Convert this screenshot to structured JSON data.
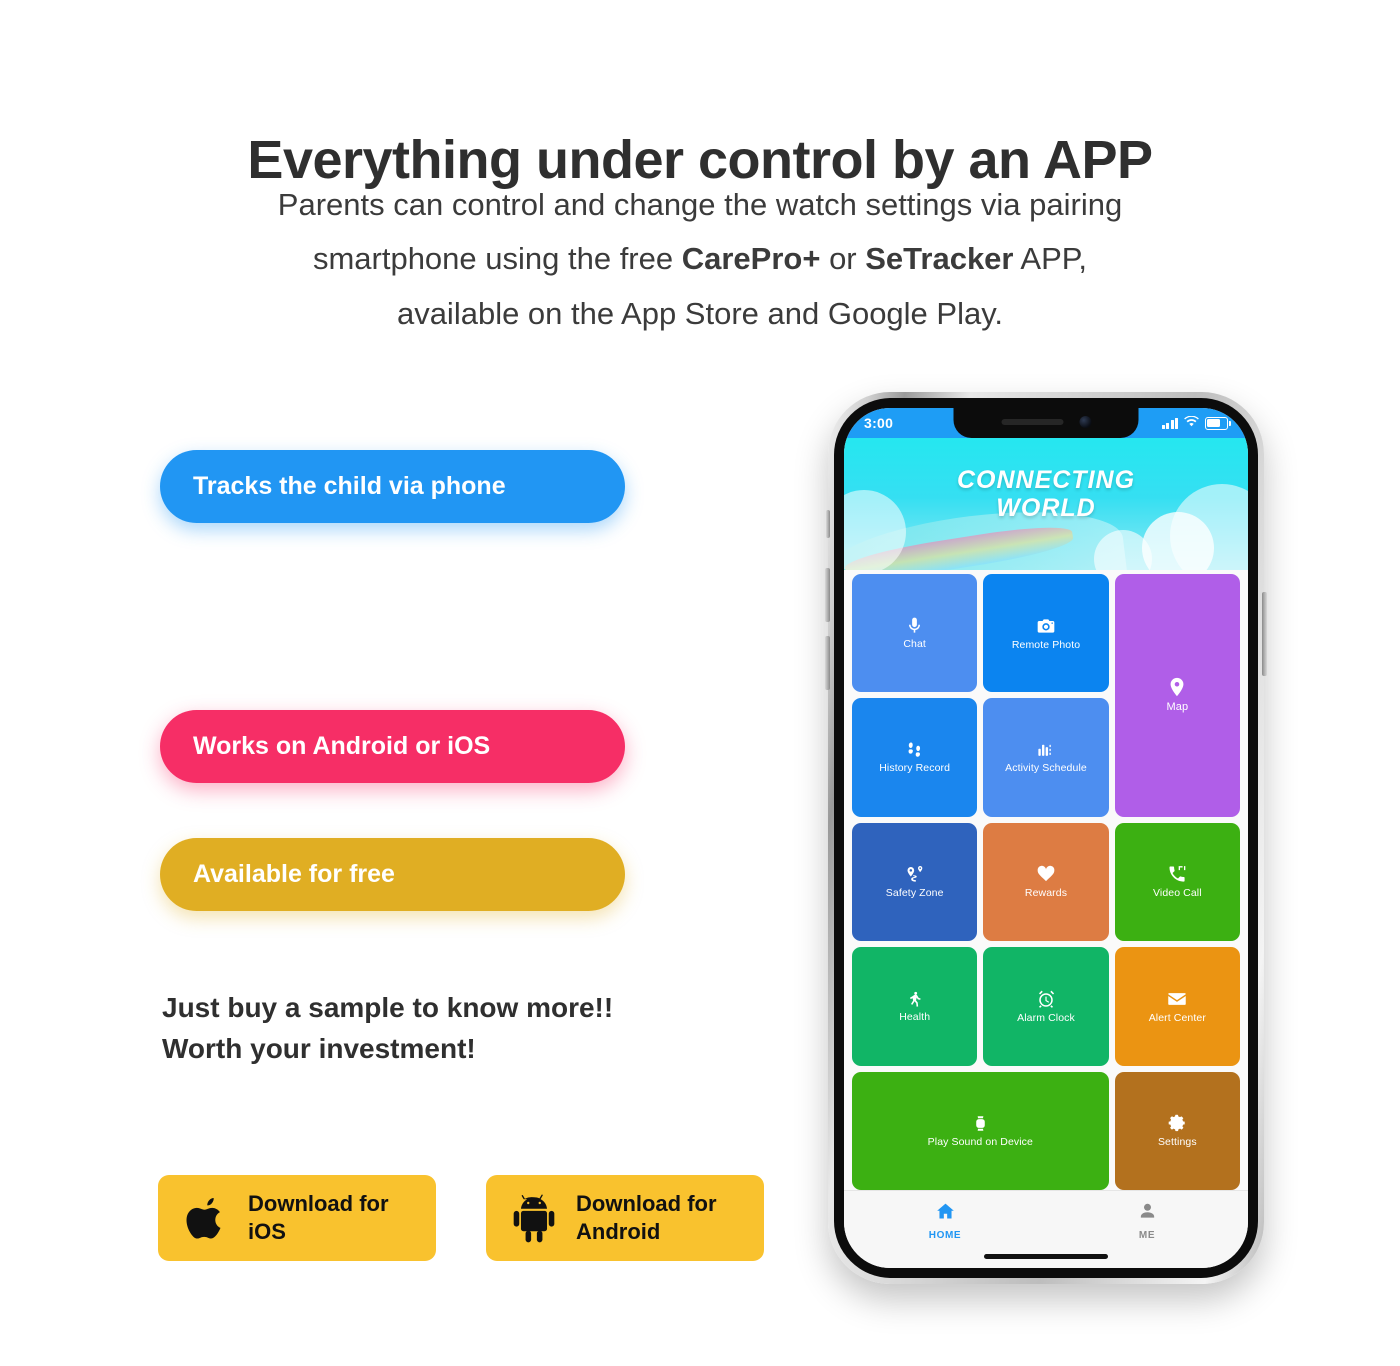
{
  "header": {
    "headline": "Everything under control by an APP",
    "sub_line1_a": "Parents can control and change the watch settings via pairing",
    "sub_line2_a": "smartphone using the free ",
    "sub_line2_b": "CarePro+",
    "sub_line2_c": " or ",
    "sub_line2_d": "SeTracker",
    "sub_line2_e": " APP,",
    "sub_line3": "available on the App Store and Google Play."
  },
  "features": [
    {
      "label": "Tracks the child via phone",
      "color": "#2196f3"
    },
    {
      "label": "Works on Android or iOS",
      "color": "#f62e66"
    },
    {
      "label": "Available for free",
      "color": "#e0ae23"
    }
  ],
  "tagline": {
    "line1": "Just buy a sample to know more!!",
    "line2": "Worth your investment!"
  },
  "downloads": [
    {
      "icon": "apple-icon",
      "line1": "Download for",
      "line2": "iOS",
      "color": "#f9c22e"
    },
    {
      "icon": "android-icon",
      "line1": "Download for",
      "line2": "Android",
      "color": "#f9c22e"
    }
  ],
  "phone": {
    "statusbar": {
      "time": "3:00",
      "signal_icon": "cellular-signal-icon",
      "wifi_icon": "wifi-icon",
      "battery_icon": "battery-icon"
    },
    "banner": {
      "title_line1": "CONNECTING",
      "title_line2": "WORLD"
    },
    "tiles": [
      {
        "label": "Chat",
        "icon": "microphone-icon",
        "color": "#4d8ef0",
        "span": "1x1"
      },
      {
        "label": "Remote Photo",
        "icon": "camera-icon",
        "color": "#0b84f0",
        "span": "1x1"
      },
      {
        "label": "Map",
        "icon": "map-pin-icon",
        "color": "#b05ee8",
        "span": "1x2"
      },
      {
        "label": "History Record",
        "icon": "footprints-icon",
        "color": "#1a86ee",
        "span": "1x1"
      },
      {
        "label": "Activity Schedule",
        "icon": "bar-chart-icon",
        "color": "#4d8ef0",
        "span": "1x1"
      },
      {
        "label": "Safety Zone",
        "icon": "geofence-icon",
        "color": "#2f63bd",
        "span": "1x1"
      },
      {
        "label": "Rewards",
        "icon": "heart-icon",
        "color": "#dd7c43",
        "span": "1x1"
      },
      {
        "label": "Video Call",
        "icon": "video-call-icon",
        "color": "#3cb012",
        "span": "1x1"
      },
      {
        "label": "Health",
        "icon": "walking-person-icon",
        "color": "#11b566",
        "span": "1x1"
      },
      {
        "label": "Alarm Clock",
        "icon": "alarm-clock-icon",
        "color": "#11b566",
        "span": "1x1"
      },
      {
        "label": "Alert Center",
        "icon": "envelope-icon",
        "color": "#eb9412",
        "span": "1x1"
      },
      {
        "label": "Play Sound on Device",
        "icon": "smartwatch-icon",
        "color": "#3cb012",
        "span": "2x1"
      },
      {
        "label": "Settings",
        "icon": "gear-icon",
        "color": "#b3711e",
        "span": "1x1"
      }
    ],
    "nav": [
      {
        "label": "HOME",
        "icon": "home-icon",
        "active": true
      },
      {
        "label": "ME",
        "icon": "person-icon",
        "active": false
      }
    ]
  }
}
